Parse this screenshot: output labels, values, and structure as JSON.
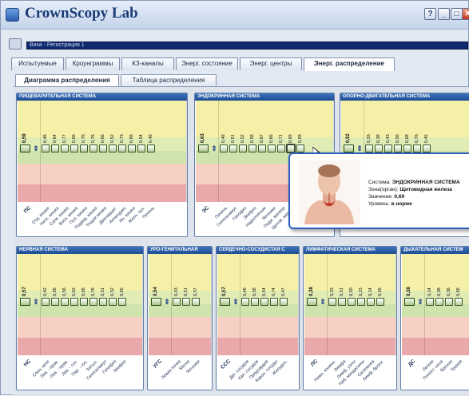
{
  "window": {
    "title": "CrownScopy Lab",
    "help_btn": "?",
    "min_btn": "_",
    "max_btn": "□",
    "close_btn": "✕"
  },
  "toolbar": {
    "address": "Вика - Регистрация 1"
  },
  "tabs": [
    "Испытуемые",
    "Кроунграммы",
    "КЗ-каналы",
    "Энерг. состояние",
    "Энерг. центры",
    "Энерг. распределение"
  ],
  "subtabs": [
    "Диаграмма распределения",
    "Таблица распределения"
  ],
  "colors": {
    "zone1": "#f5f0a8",
    "zone2": "#e0ecb4",
    "zone3": "#cfe3ad",
    "zone4": "#f6d0c2",
    "zone5": "#e9a9ab",
    "title": "#2a5fa8"
  },
  "panels": [
    {
      "title": "ПИЩЕВАРИТЕЛЬНАЯ СИСТЕМА",
      "main": {
        "label": "ПС",
        "value": "0,59"
      },
      "bars": [
        [
          "0,46",
          "Отд. кишки"
        ],
        [
          "0,64",
          "Нисх. кишка"
        ],
        [
          "0,77",
          "Сигм. кишка"
        ],
        [
          "0,66",
          "Восх. кишка"
        ],
        [
          "0,76",
          "Поп. кишка"
        ],
        [
          "0,76",
          "Подвзд. кишка"
        ],
        [
          "0,66",
          "Тощая кишка"
        ],
        [
          "0,52",
          "Двенадцат."
        ],
        [
          "0,73",
          "Аппендикс"
        ],
        [
          "0,68",
          "Ин. кишка"
        ],
        [
          "0,54",
          "Желч. пуз."
        ],
        [
          "0,46",
          "Печень"
        ]
      ]
    },
    {
      "title": "ЭНДОКРИННАЯ СИСТЕМА",
      "main": {
        "label": "ЭС",
        "value": "0,63"
      },
      "bars": [
        [
          "0,48",
          "Печень"
        ],
        [
          "0,51",
          "Гипоталамус"
        ],
        [
          "0,52",
          "Гипофиз"
        ],
        [
          "0,56",
          "Эпифиз"
        ],
        [
          "0,67",
          "Надпочечник"
        ],
        [
          "0,66",
          "Яичники"
        ],
        [
          "0,71",
          "Подж. железа"
        ],
        [
          "0,69",
          "Щитов. железа"
        ],
        [
          "0,59",
          "Легкие"
        ]
      ]
    },
    {
      "title": "ОПОРНО-ДВИГАТЕЛЬНАЯ СИСТЕМА",
      "main": {
        "label": "ОДС",
        "value": "0,52"
      },
      "bars": [
        [
          "0,33",
          "Шея"
        ],
        [
          "0,38",
          "Грудь"
        ],
        [
          "0,43",
          "Каз. кости"
        ],
        [
          "0,56",
          "Поясница"
        ],
        [
          "0,68",
          "Крестец"
        ],
        [
          "0,76",
          "Бедро"
        ],
        [
          "0,45",
          "Колено"
        ]
      ]
    },
    {
      "title": "НЕРВНАЯ СИСТЕМА",
      "main": {
        "label": "НС",
        "value": "0,57"
      },
      "bars": [
        [
          "0,42",
          "Спин. мозг"
        ],
        [
          "0,56",
          "Лев. - прав."
        ],
        [
          "0,56",
          "Лев. - прав."
        ],
        [
          "0,62",
          "Лев. - гол."
        ],
        [
          "0,68",
          "Пар. - гол."
        ],
        [
          "0,76",
          "Затыл."
        ],
        [
          "0,51",
          "Гипоталамус"
        ],
        [
          "0,52",
          "Гипофиз"
        ],
        [
          "0,65",
          "Эпифиз"
        ]
      ]
    },
    {
      "title": "УРО-ГЕНИТАЛЬНАЯ",
      "main": {
        "label": "УГС",
        "value": "0,54"
      },
      "bars": [
        [
          "0,43",
          "Левая почка"
        ],
        [
          "0,51",
          "Матка"
        ],
        [
          "0,57",
          "Яичники"
        ]
      ]
    },
    {
      "title": "СЕРДЕЧНО-СОСУДИСТАЯ С",
      "main": {
        "label": "ССС",
        "value": "0,57"
      },
      "bars": [
        [
          "0,46",
          "Дег. сосудов"
        ],
        [
          "0,58",
          "Кап. сосудов"
        ],
        [
          "0,64",
          "Предсердия"
        ],
        [
          "0,74",
          "Корон. сосуды"
        ],
        [
          "0,47",
          "Желудоч."
        ]
      ]
    },
    {
      "title": "ЛИМФАТИЧЕСКАЯ СИСТЕМА",
      "main": {
        "label": "ЛС",
        "value": "0,38"
      },
      "bars": [
        [
          "0,33",
          "Нижн. конечн."
        ],
        [
          "0,51",
          "Лимфа"
        ],
        [
          "0,50",
          "Лимф. узлы"
        ],
        [
          "0,23",
          "Неб. миндалины"
        ],
        [
          "0,14",
          "Селезенка"
        ],
        [
          "0,59",
          "Лимф. бронх."
        ]
      ]
    },
    {
      "title": "ДЫХАТЕЛЬНАЯ СИСТЕМ",
      "main": {
        "label": "ДС",
        "value": "0,38"
      },
      "bars": [
        [
          "0,14",
          "Легкие"
        ],
        [
          "0,38",
          "Полост. носа"
        ],
        [
          "0,36",
          "Бронхи"
        ],
        [
          "0,56",
          "Трахея"
        ]
      ]
    }
  ],
  "tooltip": {
    "line1_label": "Система:",
    "line1_value": "ЭНДОКРИННАЯ СИСТЕМА",
    "line2_label": "Зона(орган):",
    "line2_value": "Щитовидная железа",
    "line3_label": "Значение:",
    "line3_value": "0,69",
    "line4_label": "Уровень:",
    "line4_value": "в норме"
  }
}
